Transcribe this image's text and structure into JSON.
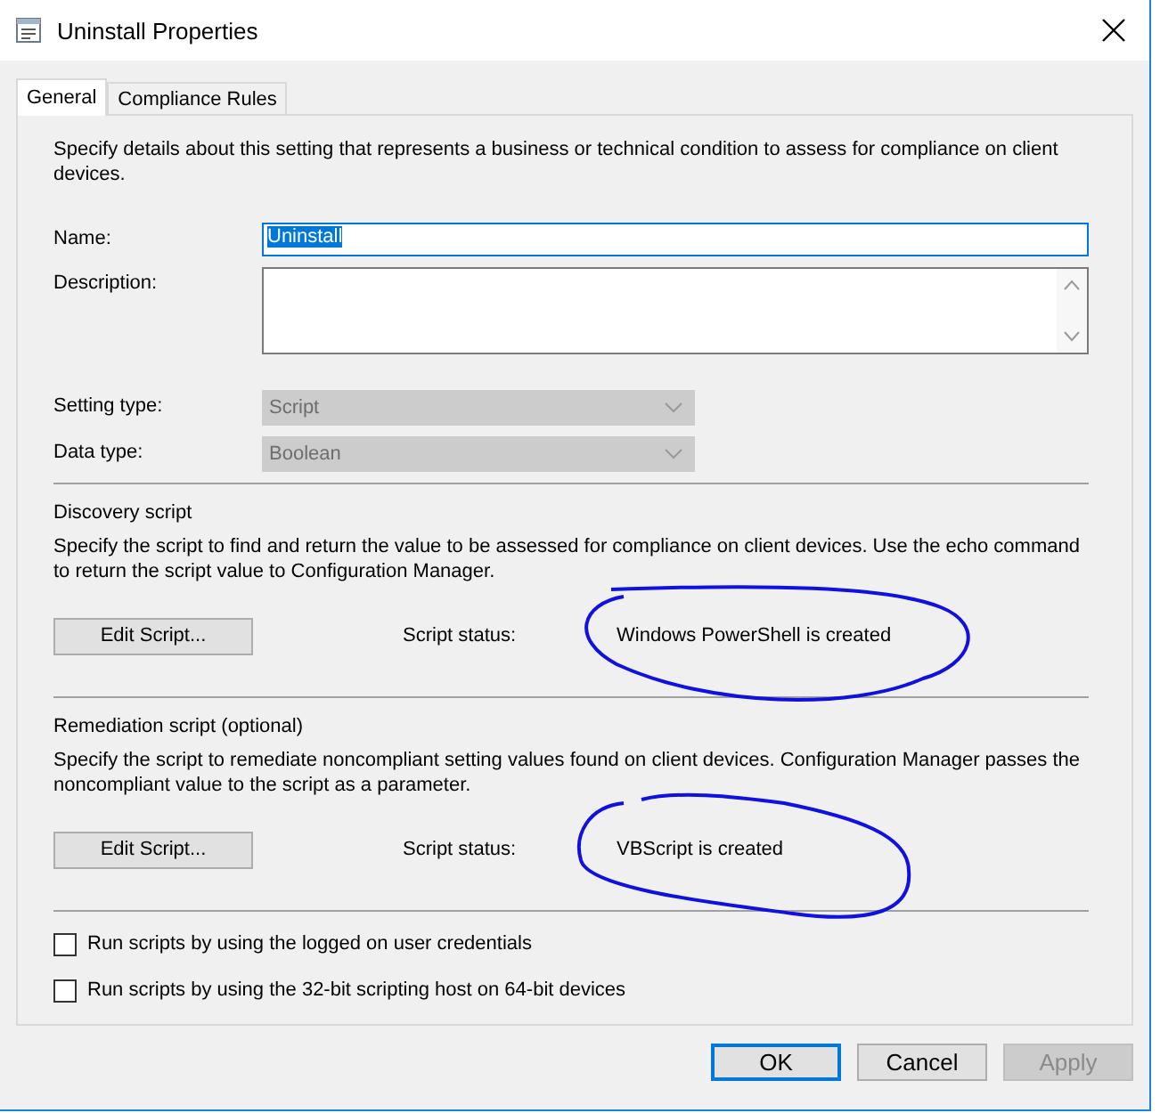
{
  "window": {
    "title": "Uninstall Properties"
  },
  "tabs": [
    {
      "label": "General",
      "selected": true
    },
    {
      "label": "Compliance Rules",
      "selected": false
    }
  ],
  "intro": "Specify details about this setting that represents a business or technical condition to assess for compliance on client devices.",
  "fields": [
    {
      "kind": "text",
      "label": "Name:",
      "value": "Uninstall",
      "value_selected": true,
      "focused": true
    },
    {
      "kind": "textarea",
      "label": "Description:"
    },
    {
      "kind": "select",
      "label": "Setting type:",
      "value": "Script",
      "disabled": true
    },
    {
      "kind": "select",
      "label": "Data type:",
      "value": "Boolean",
      "disabled": true
    }
  ],
  "scripts": [
    {
      "heading": "Discovery script",
      "description": "Specify the script to find and return the value to be assessed for compliance on client devices. Use the echo command to return the script value to Configuration Manager.",
      "button": "Edit Script...",
      "status_label": "Script status:",
      "status": "Windows PowerShell is created",
      "circled": true
    },
    {
      "heading": "Remediation script (optional)",
      "description": "Specify the script to remediate noncompliant setting values found on client devices. Configuration Manager passes the noncompliant value to the script as a parameter.",
      "button": "Edit Script...",
      "status_label": "Script status:",
      "status": "VBScript is created",
      "circled": true
    }
  ],
  "options": [
    {
      "label": "Run scripts by using the logged on user credentials",
      "checked": false
    },
    {
      "label": "Run scripts by using the 32-bit scripting host on 64-bit devices",
      "checked": false
    }
  ],
  "buttons": [
    {
      "label": "OK",
      "default": true,
      "disabled": false
    },
    {
      "label": "Cancel",
      "default": false,
      "disabled": false
    },
    {
      "label": "Apply",
      "default": false,
      "disabled": true
    }
  ]
}
